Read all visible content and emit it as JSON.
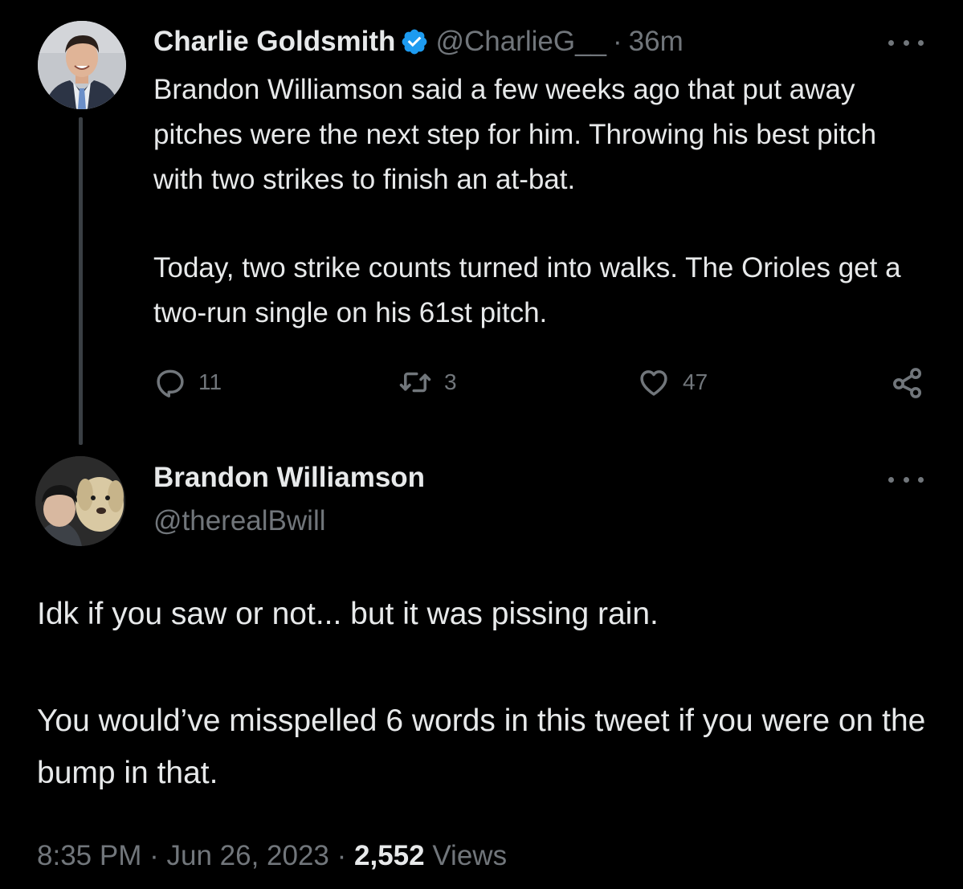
{
  "parent_tweet": {
    "author_name": "Charlie Goldsmith",
    "author_handle": "@CharlieG__",
    "separator": "·",
    "time": "36m",
    "text_paragraph_1": "Brandon Williamson said a few weeks ago that put away pitches were the next step for him. Throwing his best pitch with two strikes to finish an at-bat.",
    "text_paragraph_2": "Today, two strike counts turned into walks. The Orioles get a two-run single on his 61st pitch.",
    "replies_count": "11",
    "retweets_count": "3",
    "likes_count": "47",
    "icons": {
      "verified": "verified-badge-icon",
      "more": "more-icon",
      "reply": "reply-icon",
      "retweet": "retweet-icon",
      "like": "heart-icon",
      "share": "share-icon"
    }
  },
  "reply_tweet": {
    "author_name": "Brandon Williamson",
    "author_handle": "@therealBwill",
    "text_paragraph_1": "Idk if you saw or not... but it was pissing rain.",
    "text_paragraph_2": "You would’ve misspelled 6 words in this tweet if you were on the bump in that.",
    "time": "8:35 PM",
    "separator": "·",
    "date": "Jun 26, 2023",
    "views_count": "2,552",
    "views_label": "Views"
  },
  "colors": {
    "background": "#000000",
    "primary_text": "#e7e9ea",
    "secondary_text": "#71767b",
    "verified_blue": "#1d9bf0",
    "thread_line": "#3a3f44"
  }
}
